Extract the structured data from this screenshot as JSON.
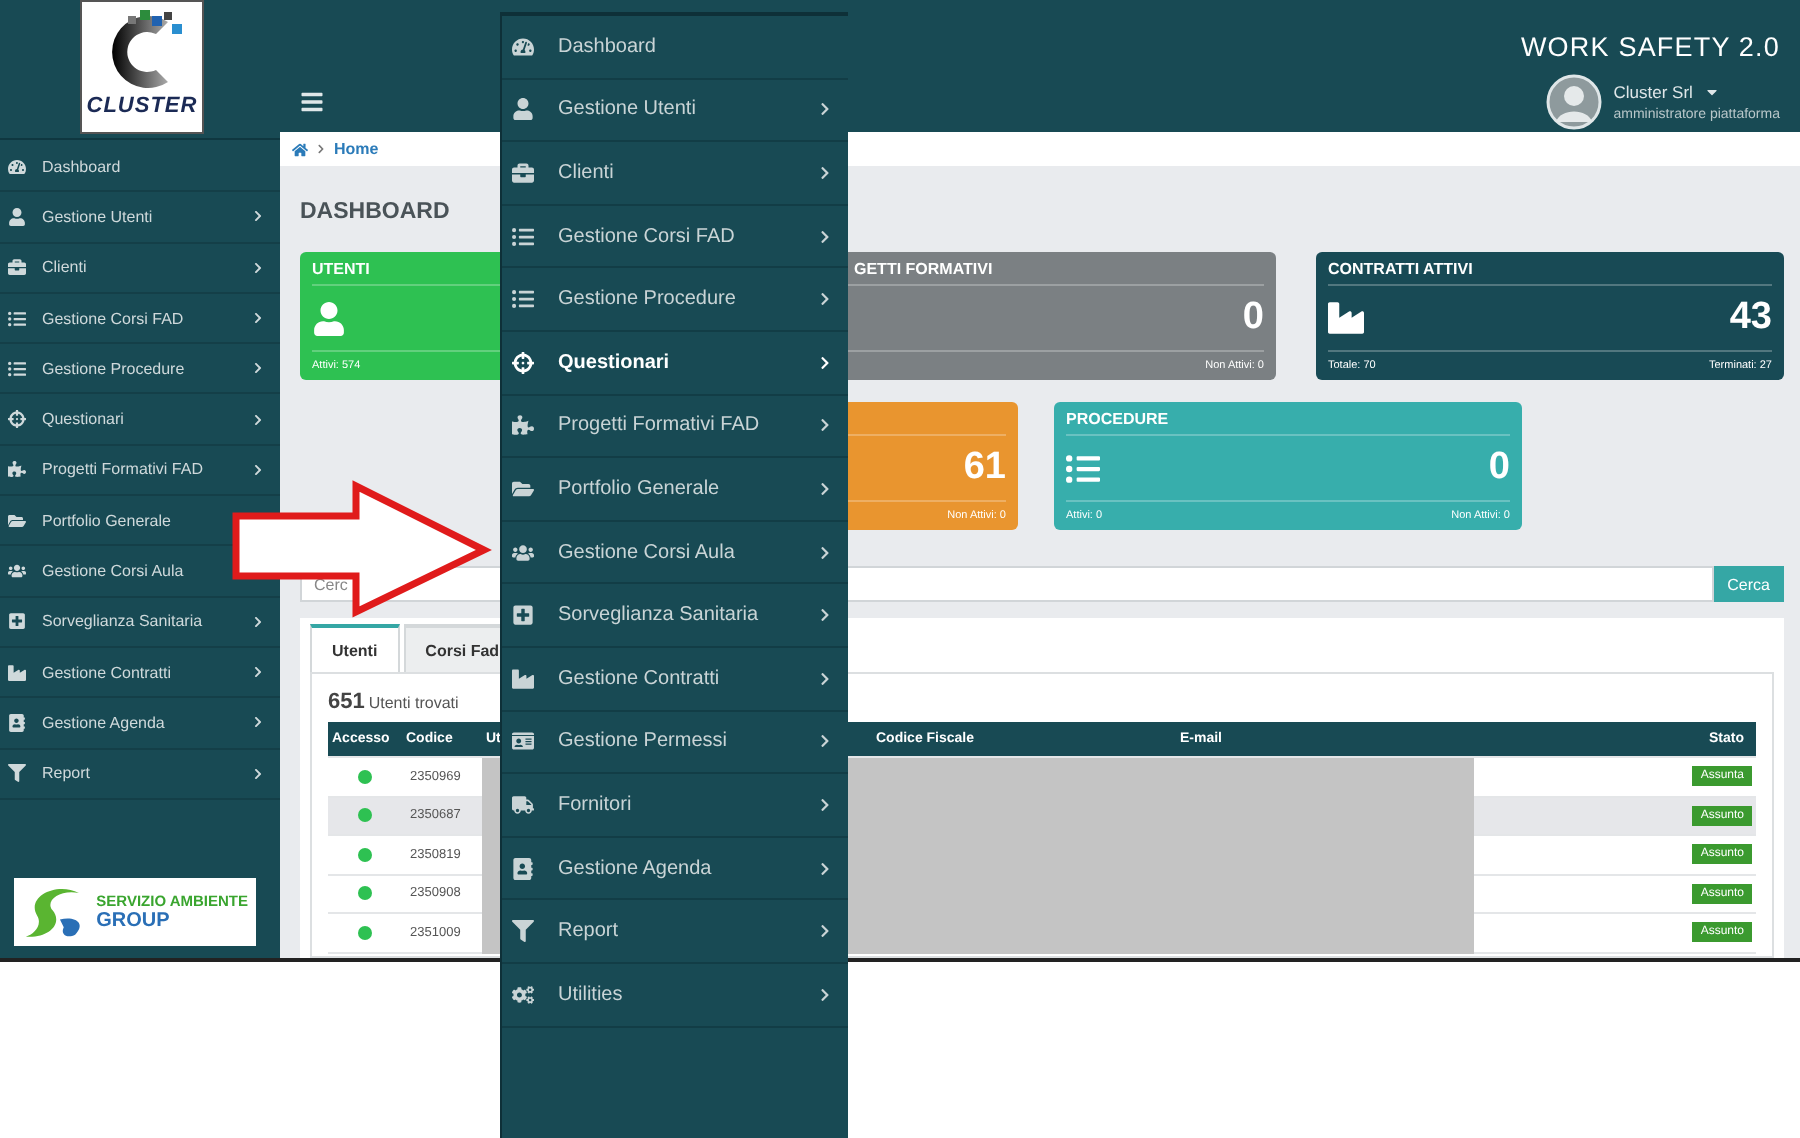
{
  "logo": {
    "name": "CLUSTER"
  },
  "header": {
    "title": "WORK SAFETY 2.0",
    "user": {
      "name": "Cluster Srl",
      "role": "amministratore piattaforma"
    }
  },
  "sidebar": {
    "items": [
      {
        "label": "Dashboard",
        "submenu": false
      },
      {
        "label": "Gestione Utenti",
        "submenu": true
      },
      {
        "label": "Clienti",
        "submenu": true
      },
      {
        "label": "Gestione Corsi FAD",
        "submenu": true
      },
      {
        "label": "Gestione Procedure",
        "submenu": true
      },
      {
        "label": "Questionari",
        "submenu": true
      },
      {
        "label": "Progetti Formativi FAD",
        "submenu": true
      },
      {
        "label": "Portfolio Generale"
      },
      {
        "label": "Gestione Corsi Aula"
      },
      {
        "label": "Sorveglianza Sanitaria",
        "submenu": true
      },
      {
        "label": "Gestione Contratti",
        "submenu": true
      },
      {
        "label": "Gestione Agenda",
        "submenu": true
      },
      {
        "label": "Report",
        "submenu": true
      }
    ],
    "footer_logo": {
      "line_1": "SERVIZIO AMBIENTE",
      "line_2": "GROUP"
    }
  },
  "breadcrumb": [
    "Home"
  ],
  "page_title": "DASHBOARD",
  "card_rows": [
    [
      {
        "title": "UTENTI",
        "color": "#2ec152",
        "footer_left": "Attivi: 574"
      },
      {
        "title": "GETTI FORMATIVI",
        "color": "#7b8083",
        "value": "0",
        "footer_right": "Non Attivi: 0"
      },
      {
        "title": "CONTRATTI ATTIVI",
        "color": "#184a55",
        "value": "43",
        "footer_left": "Totale: 70",
        "footer_right": "Terminati: 27"
      }
    ],
    [
      {
        "color": "#e9952f",
        "value": "61",
        "footer_right": "Non Attivi: 0"
      },
      {
        "title": "PROCEDURE",
        "color": "#37aeac",
        "value": "0",
        "footer_left": "Attivi: 0",
        "footer_right": "Non Attivi: 0"
      }
    ]
  ],
  "search": {
    "placeholder": "Cerc",
    "button": "Cerca"
  },
  "tabs": [
    {
      "label": "Utenti",
      "selected": true
    },
    {
      "label": "Corsi Fad",
      "selected": false
    }
  ],
  "results": {
    "count": "651",
    "label": "Utenti trovati"
  },
  "table": {
    "columns": [
      "Accesso",
      "Codice",
      "Ut",
      "Codice Fiscale",
      "E-mail",
      "Stato"
    ],
    "rows": [
      {
        "online": true,
        "code": "2350969",
        "status": "Assunta",
        "selected": false
      },
      {
        "online": true,
        "code": "2350687",
        "status": "Assunto",
        "selected": true
      },
      {
        "online": true,
        "code": "2350819",
        "status": "Assunto",
        "selected": false
      },
      {
        "online": true,
        "code": "2350908",
        "status": "Assunto",
        "selected": false
      },
      {
        "online": true,
        "code": "2351009",
        "status": "Assunto",
        "selected": false
      }
    ]
  },
  "overlay_menu": {
    "items": [
      {
        "label": "Dashboard",
        "submenu": false,
        "selected": false
      },
      {
        "label": "Gestione Utenti",
        "submenu": true,
        "selected": false
      },
      {
        "label": "Clienti",
        "submenu": true,
        "selected": false
      },
      {
        "label": "Gestione Corsi FAD",
        "submenu": true,
        "selected": false
      },
      {
        "label": "Gestione Procedure",
        "submenu": true,
        "selected": false
      },
      {
        "label": "Questionari",
        "submenu": true,
        "selected": true
      },
      {
        "label": "Progetti Formativi FAD",
        "submenu": true,
        "selected": false
      },
      {
        "label": "Portfolio Generale",
        "submenu": true,
        "selected": false
      },
      {
        "label": "Gestione Corsi Aula",
        "submenu": true,
        "selected": false
      },
      {
        "label": "Sorveglianza Sanitaria",
        "submenu": true,
        "selected": false
      },
      {
        "label": "Gestione Contratti",
        "submenu": true,
        "selected": false
      },
      {
        "label": "Gestione Permessi",
        "submenu": true,
        "selected": false
      },
      {
        "label": "Fornitori",
        "submenu": true,
        "selected": false
      },
      {
        "label": "Gestione Agenda",
        "submenu": true,
        "selected": false
      },
      {
        "label": "Report",
        "submenu": true,
        "selected": false
      },
      {
        "label": "Utilities",
        "submenu": true,
        "selected": false
      }
    ]
  }
}
